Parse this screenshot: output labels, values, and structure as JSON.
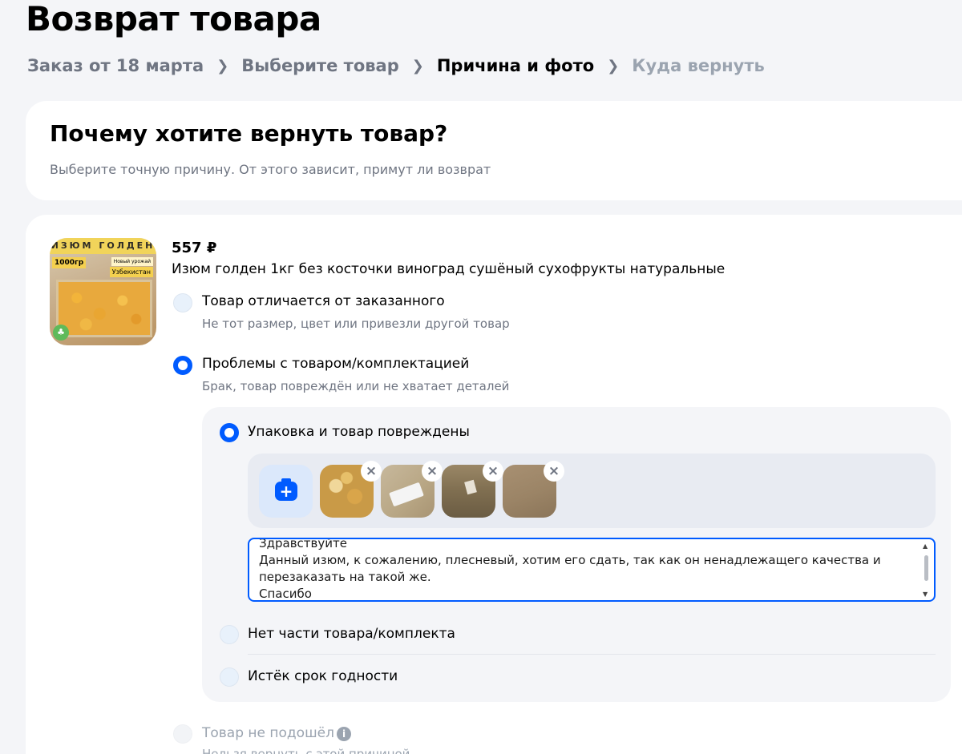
{
  "page": {
    "title": "Возврат товара"
  },
  "breadcrumb": [
    {
      "label": "Заказ от 18 марта",
      "state": "done"
    },
    {
      "label": "Выберите товар",
      "state": "done"
    },
    {
      "label": "Причина и фото",
      "state": "active"
    },
    {
      "label": "Куда вернуть",
      "state": "future"
    }
  ],
  "question": {
    "title": "Почему хотите вернуть товар?",
    "subtitle": "Выберите точную причину. От этого зависит, примут ли возврат"
  },
  "product": {
    "price": "557 ₽",
    "name": "Изюм голден 1кг без косточки виноград сушёный сухофрукты натуральные",
    "image_text": {
      "banner": "ИЗЮМ ГОЛДЕН",
      "weight": "1000гр",
      "harvest": "Новый урожай",
      "country": "Узбекистан"
    }
  },
  "reasons": [
    {
      "label": "Товар отличается от заказанного",
      "hint": "Не тот размер, цвет или привезли другой товар",
      "selected": false
    },
    {
      "label": "Проблемы с товаром/комплектацией",
      "hint": "Брак, товар повреждён или не хватает деталей",
      "selected": true
    },
    {
      "label": "Товар не подошёл",
      "hint": "Нельзя вернуть с этой причиной",
      "selected": false,
      "disabled": true
    }
  ],
  "sub_reasons": [
    {
      "label": "Упаковка и товар повреждены",
      "selected": true
    },
    {
      "label": "Нет части товара/комплекта",
      "selected": false
    },
    {
      "label": "Истёк срок годности",
      "selected": false
    }
  ],
  "photos": {
    "count": 4,
    "remove_glyph": "×",
    "add_icon": "camera-plus-icon"
  },
  "comment": {
    "lines": [
      "Здравствуйте",
      "Данный изюм, к сожалению, плесневый, хотим его сдать, так как он ненадлежащего качества и",
      "перезаказать на такой же.",
      "Спасибо"
    ]
  },
  "colors": {
    "accent": "#005bff",
    "muted": "#6f7582",
    "background": "#f4f5f8"
  }
}
